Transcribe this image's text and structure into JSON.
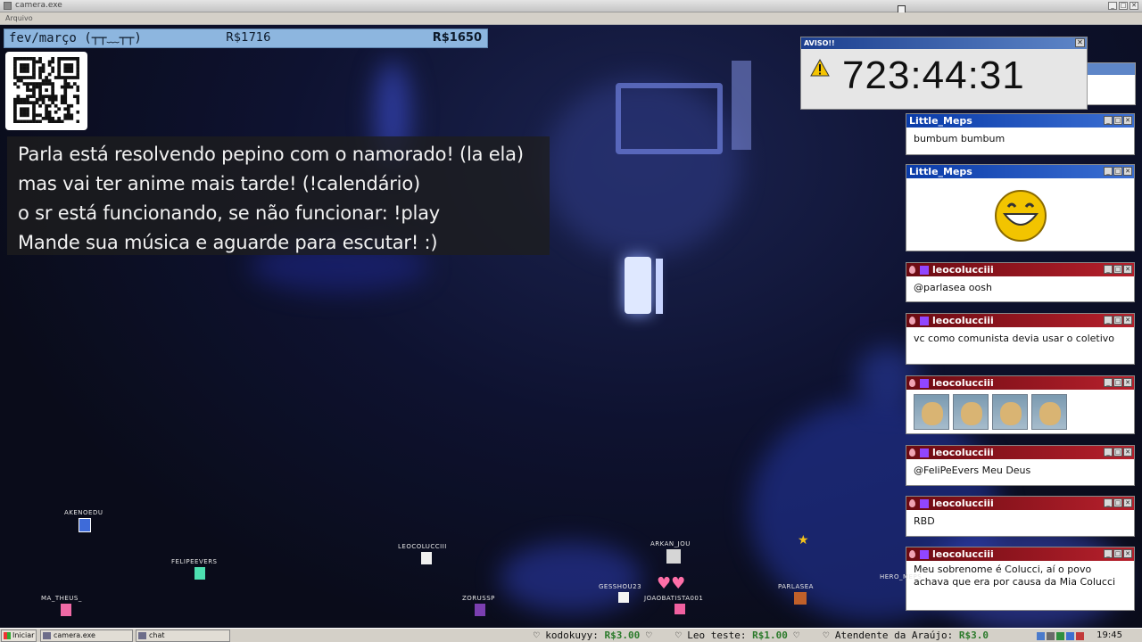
{
  "window": {
    "title": "camera.exe",
    "menu_label": "Arquivo",
    "controls": [
      "_",
      "□",
      "✕"
    ]
  },
  "overlay": {
    "period": "fev/março (┬┬﹏┬┬)",
    "value_left": "R$1716",
    "value_right": "R$1650",
    "notice_lines": [
      "Parla está resolvendo pepino com o namorado! (la ela)",
      "mas vai ter anime mais tarde! (!calendário)",
      "o sr está funcionando, se não funcionar: !play",
      "Mande sua música e aguarde para escutar! :)"
    ]
  },
  "aviso": {
    "title": "AVISO!!",
    "timer": "723:44:31"
  },
  "chat": [
    {
      "user": "Little_Meps",
      "style": "blue",
      "text": "bumbum bumbum"
    },
    {
      "user": "Little_Meps",
      "style": "blue",
      "text": "",
      "emote": "grin-emote"
    },
    {
      "user": "leocolucciii",
      "style": "red",
      "text": "@parlasea oosh"
    },
    {
      "user": "leocolucciii",
      "style": "red",
      "text": "vc como comunista devia usar o coletivo"
    },
    {
      "user": "leocolucciii",
      "style": "red",
      "text": "",
      "emote": "doge-emote-row"
    },
    {
      "user": "leocolucciii",
      "style": "red",
      "text": "@FeliPeEvers Meu Deus"
    },
    {
      "user": "leocolucciii",
      "style": "red",
      "text": "RBD"
    },
    {
      "user": "leocolucciii",
      "style": "red",
      "text": "Meu sobrenome é Colucci, aí o povo achava que era por causa da Mia Colucci"
    }
  ],
  "viewers": [
    {
      "name": "AKENOEDU"
    },
    {
      "name": "FELIPEEVERS"
    },
    {
      "name": "MA_THEUS_"
    },
    {
      "name": "LEOCOLUCCIII"
    },
    {
      "name": "ZORUSSP"
    },
    {
      "name": "ARKAN_JOU"
    },
    {
      "name": "GESSHOU23"
    },
    {
      "name": "JOAOBATISTA001"
    },
    {
      "name": "PARLASEA"
    },
    {
      "name": "HERO_MEPS"
    }
  ],
  "taskbar": {
    "start": "Iniciar",
    "items": [
      "camera.exe",
      "chat"
    ],
    "ticker": [
      {
        "name": "kodokuyy:",
        "amount": "R$3.00"
      },
      {
        "name": "Leo teste:",
        "amount": "R$1.00"
      },
      {
        "name": "Atendente da Araújo:",
        "amount": "R$3.0"
      }
    ],
    "clock": "19:45"
  },
  "colors": {
    "accent_blue": "#0a3ba8",
    "accent_red": "#b7202c",
    "money_bar": "#8db6df"
  }
}
